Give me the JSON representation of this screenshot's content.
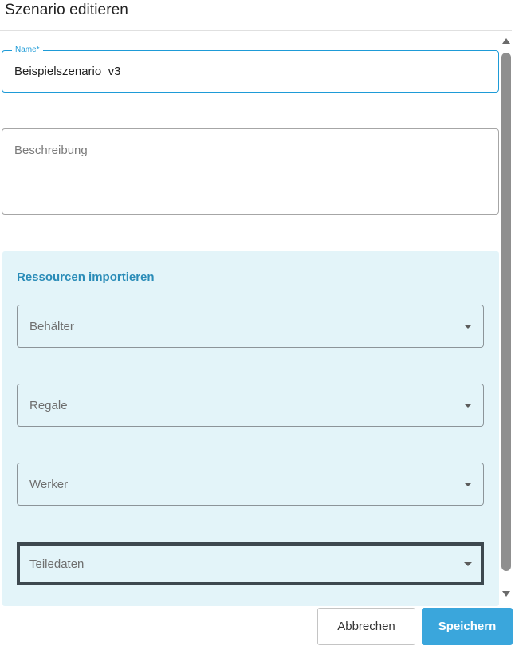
{
  "dialog": {
    "title": "Szenario editieren"
  },
  "form": {
    "name": {
      "label": "Name*",
      "value": "Beispielszenario_v3"
    },
    "description": {
      "placeholder": "Beschreibung",
      "value": ""
    }
  },
  "import_panel": {
    "heading": "Ressourcen importieren",
    "selects": [
      {
        "label": "Behälter"
      },
      {
        "label": "Regale"
      },
      {
        "label": "Werker"
      },
      {
        "label": "Teiledaten"
      }
    ]
  },
  "actions": {
    "cancel_label": "Abbrechen",
    "save_label": "Speichern"
  },
  "colors": {
    "accent": "#1e9bd7",
    "panel_background": "#e3f4f9",
    "panel_heading": "#2a8cb8",
    "primary_button": "#3aa6dc",
    "highlight_border": "#3d484f"
  },
  "icons": {
    "dropdown": "chevron-down-icon",
    "scroll_up": "arrow-up-icon",
    "scroll_down": "arrow-down-icon"
  }
}
